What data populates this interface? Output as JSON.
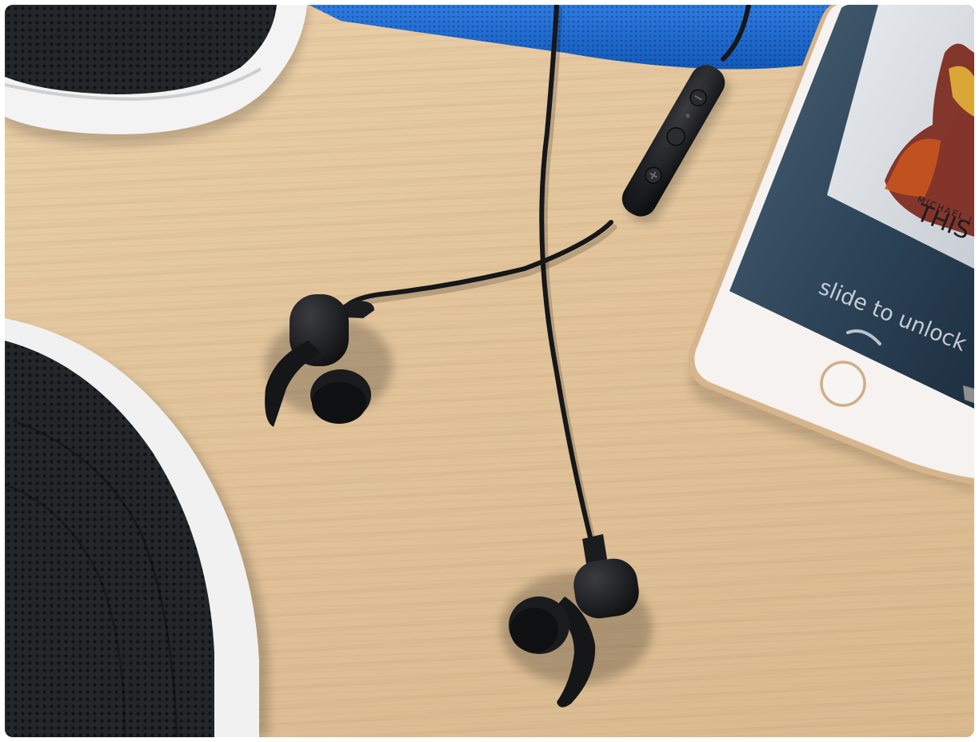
{
  "photo": {
    "subject": "Black wireless sport earbuds with inline remote on a wooden table beside sneakers, a blue towel and a smartphone",
    "colors": {
      "wood": "#e2c49b",
      "towel": "#1a63c9",
      "earbuds": "#1b1c1e",
      "phone_body": "#f4f1ee",
      "phone_rim": "#d8b890",
      "screen": "#33475c",
      "shoe_mesh": "#202224",
      "shoe_sole": "#f2f2f2"
    }
  },
  "phone_screen": {
    "album_artist": "MICHAEL J",
    "album_title": "THIS I",
    "lock_text": "slide to unlock"
  }
}
